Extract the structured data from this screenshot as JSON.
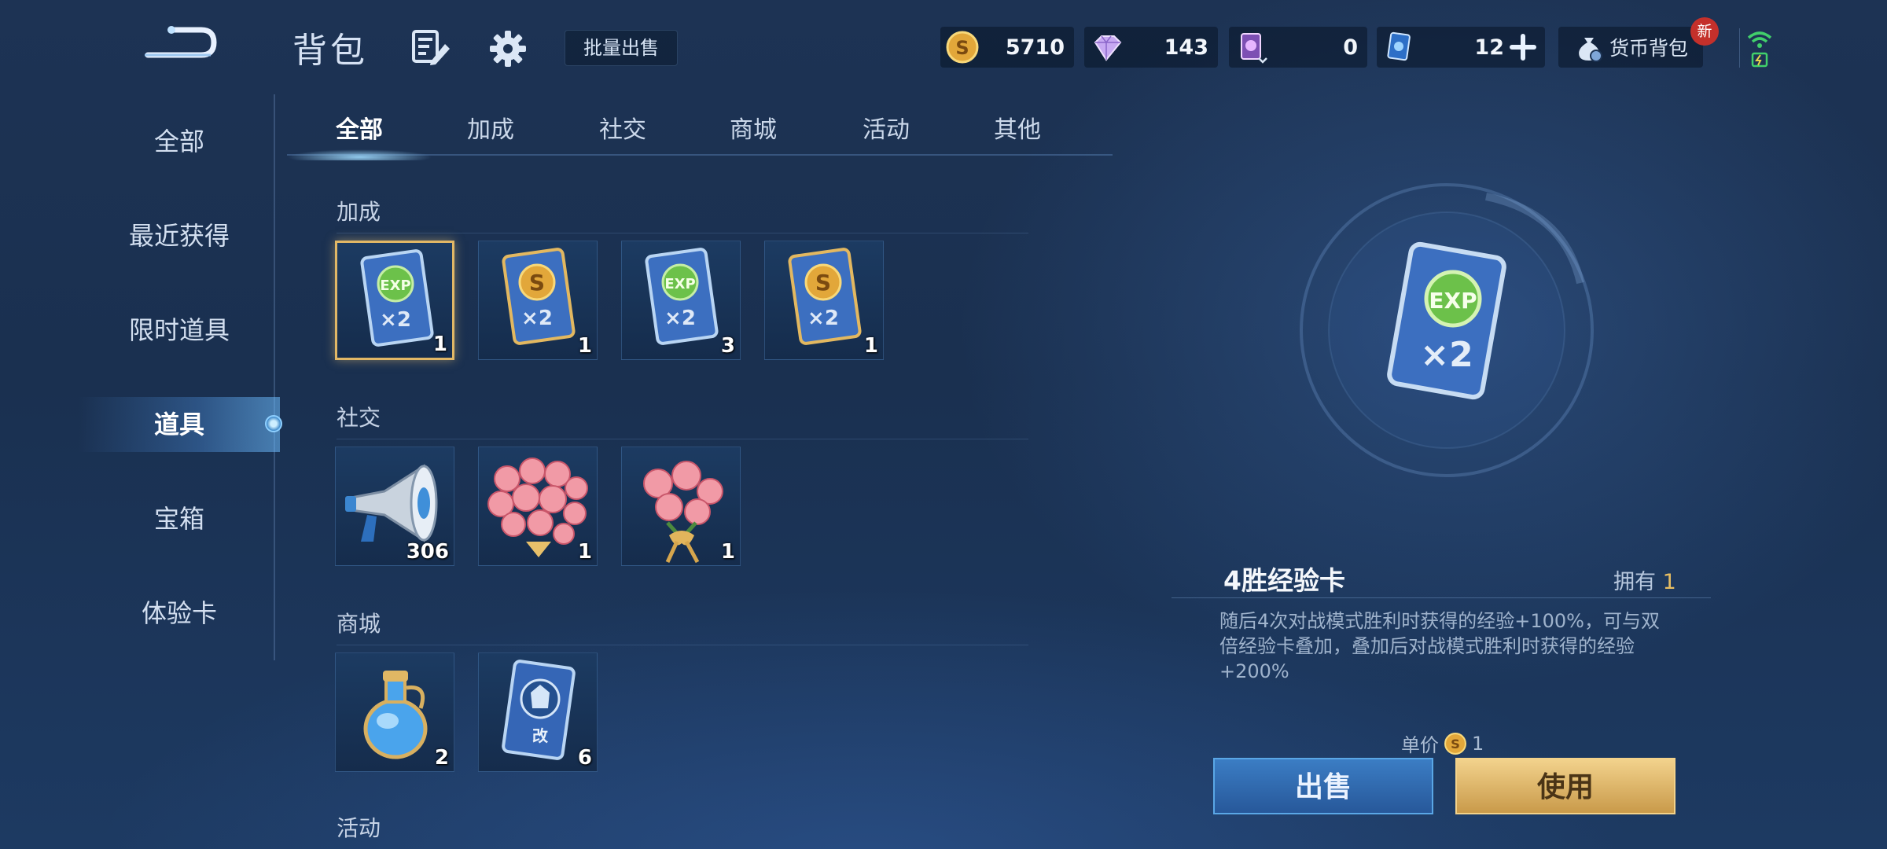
{
  "header": {
    "title": "背包",
    "batch_sell_label": "批量出售",
    "currencies": [
      {
        "icon": "gold-coin-icon",
        "value": "5710"
      },
      {
        "icon": "diamond-icon",
        "value": "143"
      },
      {
        "icon": "purple-card-icon",
        "value": "0"
      },
      {
        "icon": "blue-card-icon",
        "value": "12"
      }
    ],
    "currency_bag_label": "货币背包",
    "new_badge": "新"
  },
  "sidebar": {
    "items": [
      {
        "label": "全部"
      },
      {
        "label": "最近获得"
      },
      {
        "label": "限时道具"
      },
      {
        "label": "道具",
        "active": true
      },
      {
        "label": "宝箱"
      },
      {
        "label": "体验卡"
      }
    ]
  },
  "tabs": [
    {
      "label": "全部",
      "active": true
    },
    {
      "label": "加成"
    },
    {
      "label": "社交"
    },
    {
      "label": "商城"
    },
    {
      "label": "活动"
    },
    {
      "label": "其他"
    }
  ],
  "sections": {
    "bonus": {
      "title": "加成",
      "items": [
        {
          "icon": "exp-card-icon",
          "count": "1",
          "selected": true
        },
        {
          "icon": "gold-card-icon",
          "count": "1"
        },
        {
          "icon": "exp-card-icon",
          "count": "3"
        },
        {
          "icon": "gold-card-icon",
          "count": "1"
        }
      ]
    },
    "social": {
      "title": "社交",
      "items": [
        {
          "icon": "megaphone-icon",
          "count": "306"
        },
        {
          "icon": "rose-bouquet-large-icon",
          "count": "1"
        },
        {
          "icon": "rose-bouquet-small-icon",
          "count": "1"
        }
      ]
    },
    "shop": {
      "title": "商城",
      "items": [
        {
          "icon": "potion-bottle-icon",
          "count": "2"
        },
        {
          "icon": "rename-card-icon",
          "count": "6"
        }
      ]
    },
    "event": {
      "title": "活动"
    }
  },
  "detail": {
    "icon": "exp-card-icon",
    "name": "4胜经验卡",
    "owned_label": "拥有",
    "owned_count": "1",
    "description": "随后4次对战模式胜利时获得的经验+100%，可与双倍经验卡叠加，叠加后对战模式胜利时获得的经验+200%",
    "unit_price_label": "单价",
    "unit_price": "1",
    "sell_label": "出售",
    "use_label": "使用"
  },
  "colors": {
    "gold_accent": "#e1b766",
    "sell_button": "#3b7dc4",
    "use_button": "#f2d28c"
  }
}
